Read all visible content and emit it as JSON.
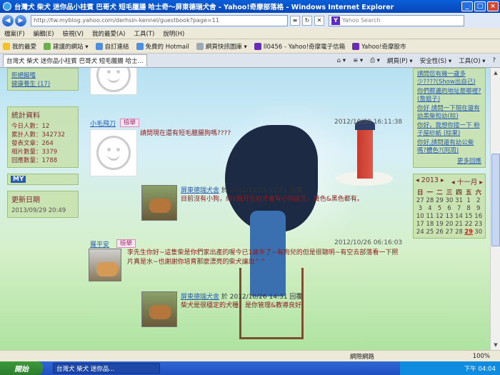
{
  "window": {
    "title": "台灣犬 柴犬 迷你品小柱賓 巴哥犬 短毛臘腸 哈士奇～屏東德瑞犬舍 - Yahoo!奇摩部落格 - Windows Internet Explorer",
    "minimize": "_",
    "maximize": "□",
    "close": "×"
  },
  "address_bar": {
    "url": "http://tw.myblog.yahoo.com/derhsin-kennel/guestbook?page=11",
    "search_placeholder": "Yahoo Search"
  },
  "menu": [
    "檔案(F)",
    "編輯(E)",
    "檢視(V)",
    "我的最愛(A)",
    "工具(T)",
    "說明(H)"
  ],
  "favorites_bar": {
    "favorites_label": "我的最愛",
    "items": [
      "建議的網站 ▾",
      "自訂連結",
      "免費的 Hotmail",
      "網頁快訊圖庫 ▾",
      "ll0456 - Yahoo!奇摩電子信箱",
      "Yahoo!奇摩股市"
    ]
  },
  "tab": {
    "label": "台灣犬 柴犬 迷你品小柱賓 巴哥犬 短毛臘腸 哈士..."
  },
  "tools": {
    "page": "網頁(P) ▾",
    "safety": "安全性(S) ▾",
    "tools": "工具(O) ▾",
    "help": "?"
  },
  "left_sidebar": {
    "links": [
      "拒絕擬嗜",
      "健康養生 (17)"
    ],
    "stats": {
      "heading": "統計資料",
      "rows": [
        "今日人數：12",
        "累計人數：342732",
        "發表文章：264",
        "相片數量：3379",
        "回應數量：1788"
      ]
    },
    "update": {
      "heading": "更新日期",
      "date": "2013/09/29 20:49"
    },
    "badge_label": "MY"
  },
  "right_sidebar": {
    "messages": [
      "請問您有幾一歲多少????(Show出自己)",
      "你們那邊的地址是哪裡?(詹姐子)",
      "你好 請問一下現在還有幼黑柴和幼(棕)",
      "你好，我想你接一下 粉子屋紗紙 (棕果)",
      "你好,請問還有幼公柴嗎?體色?(阿周)"
    ],
    "more": "更多回應",
    "calendar": {
      "year": "◂ 2013 ▸",
      "month": "◂ 十一月 ▸",
      "dow": [
        "日",
        "一",
        "二",
        "三",
        "四",
        "五",
        "六"
      ],
      "days": [
        "27",
        "28",
        "29",
        "30",
        "31",
        "1",
        "2",
        "3",
        "4",
        "5",
        "6",
        "7",
        "8",
        "9",
        "10",
        "11",
        "12",
        "13",
        "14",
        "15",
        "16",
        "17",
        "18",
        "19",
        "20",
        "21",
        "22",
        "23",
        "24",
        "25",
        "26",
        "27",
        "28",
        "29",
        "30"
      ],
      "today": "29"
    }
  },
  "posts": [
    {
      "nickname": "小毛飛刀",
      "report": "檢舉",
      "time": "2012/10/30 16:11:38",
      "message": "請問現在還有短毛臘腸狗嗎????",
      "reply_by": "屏東德瑞犬舍",
      "reply_time": "於 2012/11/01 15:11 回覆",
      "reply": "目前沒有小狗，約1個月左右才會有小狗誕生，黃色&黑色都有。"
    },
    {
      "nickname": "羅平安",
      "report": "檢舉",
      "time": "2012/10/26 06:16:03",
      "message": "李先生你好~這隻柴是你們家出產的喔今已1歲半了~有狗兒的但是很聰明~有空去部落看一下照片真是水~也謝謝你培育那麼漂亮的柴犬讓出^^",
      "reply_by": "屏東德瑞犬舍",
      "reply_time": "於 2012/10/26 14:31 回覆",
      "reply": "柴犬是很穩定的犬種，是你管理&教導良好"
    }
  ],
  "status_bar": {
    "zone": "網際網路",
    "zoom": "100%"
  },
  "taskbar": {
    "start": "開始",
    "task": "台灣犬 柴犬 迷你品...",
    "clock": "下午 04:04"
  }
}
